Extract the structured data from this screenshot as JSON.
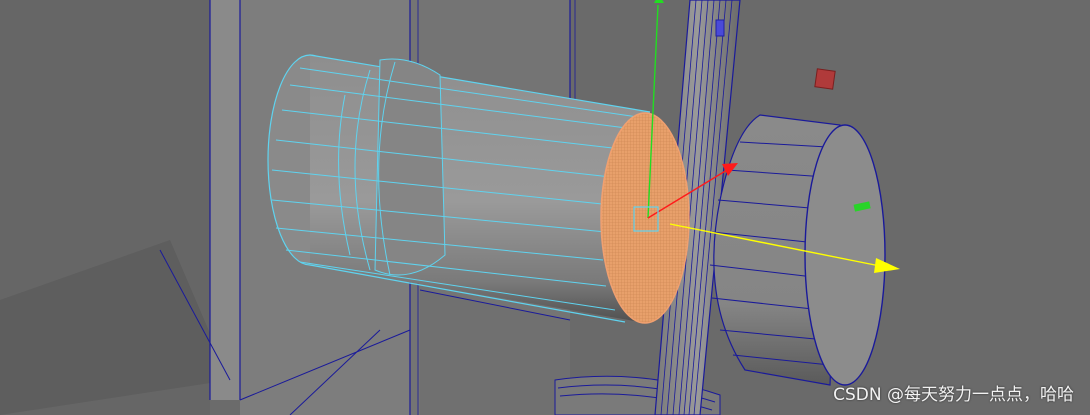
{
  "viewport": {
    "background": "#6b6b6b",
    "wireframe_color": "#1a1a9a",
    "selected_wire_color": "#5fd3ef",
    "selected_face_color": "#e8a06b"
  },
  "manipulator": {
    "x_axis_color": "#ff1a1a",
    "y_axis_color": "#22dd22",
    "z_axis_color": "#ffff00"
  },
  "watermark": {
    "text": "CSDN @每天努力一点点，哈哈"
  }
}
